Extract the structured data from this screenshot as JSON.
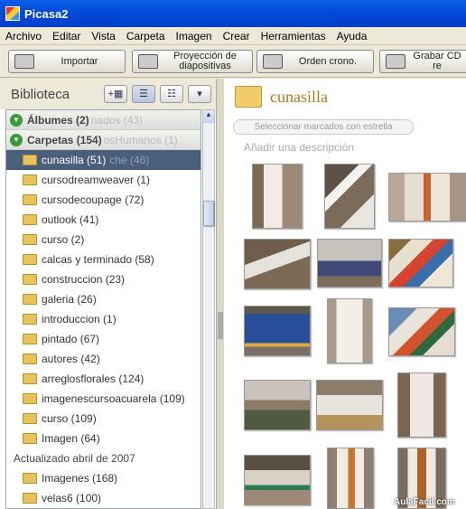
{
  "window": {
    "title": "Picasa2"
  },
  "menu": [
    "Archivo",
    "Editar",
    "Vista",
    "Carpeta",
    "Imagen",
    "Crear",
    "Herramientas",
    "Ayuda"
  ],
  "toolbar": {
    "import_label": "Importar",
    "slideshow_label": "Proyección de diapositivas",
    "timeline_label": "Orden crono.",
    "burn_label": "Grabar CD re"
  },
  "library": {
    "title": "Biblioteca",
    "groups": {
      "albums": "Álbumes (2)",
      "folders": "Carpetas (154)"
    },
    "ghost_texts": {
      "albums": "nados (43)",
      "folders": "osHumanos (1)",
      "selected": "che (46)"
    },
    "folders": [
      "cunasilla (51)",
      "cursodreamweaver (1)",
      "cursodecoupage (72)",
      "outlook (41)",
      "curso (2)",
      "calcas y terminado (58)",
      "construccion (23)",
      "galeria (26)",
      "introduccion (1)",
      "pintado (67)",
      "autores (42)",
      "arreglosflorales (124)",
      "imagenescursoacuarela (109)",
      "curso (109)",
      "Imagen (64)"
    ],
    "section": "Actualizado abril de 2007",
    "folders2": [
      "Imagenes (168)",
      "velas6 (100)"
    ]
  },
  "album": {
    "name": "cunasilla",
    "starred_button": "Seleccionar marcados con estrella",
    "description_placeholder": "Añadir una descripción"
  },
  "watermark": "AulaFacil.com",
  "colors": {
    "selection": "#4a5f7c",
    "title_bar": "#0a5ee8",
    "folder": "#e8c25a"
  }
}
